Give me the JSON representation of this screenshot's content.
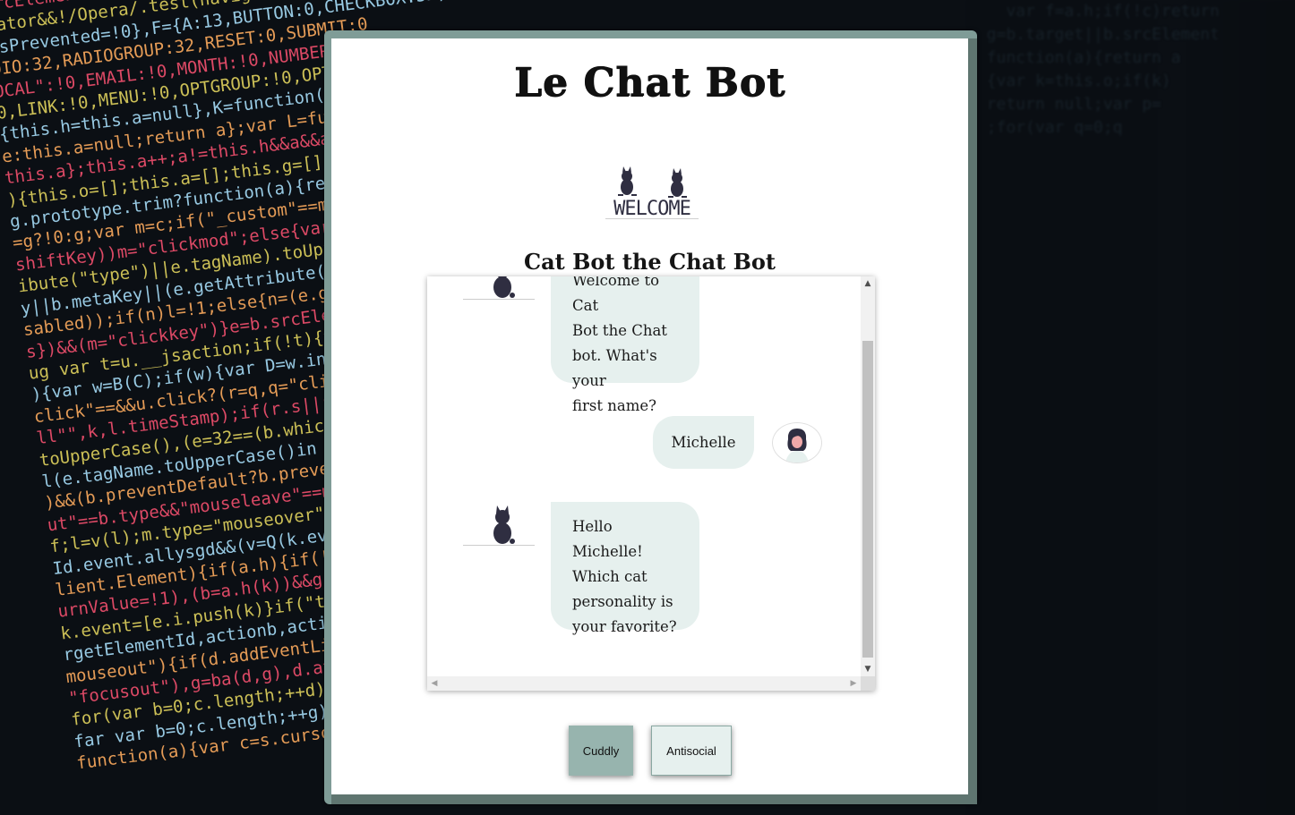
{
  "page": {
    "title": "Le Chat Bot",
    "subtitle": "Cat Bot the Chat Bot",
    "welcome_logo_text": "WELCOME"
  },
  "chat": {
    "messages": [
      {
        "from": "bot",
        "text": "Welcome to Cat Bot the Chat bot. What's your first name?",
        "lines": [
          "Welcome to Cat",
          "Bot the Chat",
          "bot. What's your",
          "first name?"
        ]
      },
      {
        "from": "user",
        "text": "Michelle"
      },
      {
        "from": "bot",
        "text": "Hello Michelle! Which cat personality is your favorite?",
        "lines": [
          "Hello Michelle!",
          "Which cat",
          "personality is",
          "your favorite?"
        ]
      }
    ]
  },
  "choices": {
    "cuddly_label": "Cuddly",
    "antisocial_label": "Antisocial"
  },
  "colors": {
    "frame": "#7f9c97",
    "bubble": "#e6f0ee",
    "cuddly_button": "#97b4ae"
  }
}
